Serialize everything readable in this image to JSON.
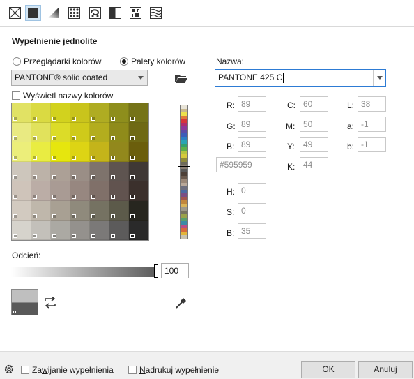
{
  "toolbar": {
    "buttons": [
      {
        "name": "no-fill-icon"
      },
      {
        "name": "uniform-fill-icon",
        "active": true
      },
      {
        "name": "fountain-fill-icon"
      },
      {
        "name": "vector-pattern-fill-icon"
      },
      {
        "name": "bitmap-pattern-fill-icon"
      },
      {
        "name": "two-color-pattern-fill-icon"
      },
      {
        "name": "texture-fill-icon"
      },
      {
        "name": "postscript-fill-icon"
      }
    ]
  },
  "section_title": "Wypełnienie jednolite",
  "mode": {
    "viewers_label": "Przeglądarki kolorów",
    "palettes_label": "Palety kolorów",
    "selected": "palettes"
  },
  "palette": {
    "selected": "PANTONE® solid coated",
    "show_names_label": "Wyświetl nazwy kolorów",
    "show_names_checked": false
  },
  "grid_colors": [
    [
      "#e1e264",
      "#dada42",
      "#d2d21e",
      "#c9c41c",
      "#afac22",
      "#8e8e1c",
      "#757318"
    ],
    [
      "#e9ea82",
      "#e1e25c",
      "#dcdc28",
      "#cfca1a",
      "#b3ad1e",
      "#8f8b1a",
      "#6f6914"
    ],
    [
      "#ecee7a",
      "#e9ec42",
      "#e6e60e",
      "#ddd414",
      "#c4b41a",
      "#92881c",
      "#6b5e0c"
    ],
    [
      "#cdc6bc",
      "#bcb2a8",
      "#aca096",
      "#9a8e86",
      "#7e736c",
      "#5e5450",
      "#3f3835"
    ],
    [
      "#cfc4ba",
      "#bbada6",
      "#a99b94",
      "#978780",
      "#807069",
      "#61534f",
      "#3b302c"
    ],
    [
      "#d2cac0",
      "#bfb7ab",
      "#a8a093",
      "#8f8a7c",
      "#757262",
      "#5c5a4a",
      "#27261f"
    ],
    [
      "#d6d3cc",
      "#c3c0ba",
      "#aba9a3",
      "#94918d",
      "#7b7978",
      "#5c5b5b",
      "#2a2a2a"
    ]
  ],
  "strip_colors": [
    "#e8e4d8",
    "#c9b98f",
    "#ece14d",
    "#e07b3a",
    "#d7363a",
    "#b02e6d",
    "#8e3a9a",
    "#5b4aa7",
    "#3b5cb8",
    "#2a7fc4",
    "#2aa3b3",
    "#34a06d",
    "#5eb04a",
    "#b5c441",
    "#d6c93c",
    "#8f8a3b",
    "#6e6a5a",
    "#8c7f74",
    "#595959",
    "#4d4038",
    "#6b5a4e",
    "#9a8777",
    "#b8a899",
    "#6d6f80",
    "#4c6aa2",
    "#7a4e85",
    "#a3564f",
    "#c2873d",
    "#d9b45a",
    "#9f9a8a",
    "#77735f",
    "#9aa24a",
    "#58a06c",
    "#3a8aa6",
    "#b94d86",
    "#d86a3a",
    "#e3b53a",
    "#c9c3b0"
  ],
  "name": {
    "label": "Nazwa:",
    "value": "PANTONE 425 C"
  },
  "values": {
    "R": "89",
    "G": "89",
    "B": "89",
    "hex": "#595959",
    "C": "60",
    "M": "50",
    "Y": "49",
    "K": "44",
    "L": "38",
    "a": "-1",
    "b": "-1",
    "H": "0",
    "S": "0",
    "Bv": "35"
  },
  "labels": {
    "R": "R:",
    "G": "G:",
    "B": "B:",
    "C": "C:",
    "M": "M:",
    "Y": "Y:",
    "K": "K:",
    "L": "L:",
    "a": "a:",
    "b": "b:",
    "H": "H:",
    "S": "S:",
    "Bv": "B:"
  },
  "tint": {
    "label": "Odcień:",
    "value": "100",
    "level": 1.0
  },
  "swatches": {
    "old": "#bfbfbf",
    "new": "#595959"
  },
  "bottom": {
    "wrap_fill_pre": "Za",
    "wrap_fill_u": "w",
    "wrap_fill_post": "ijanie wypełnienia",
    "overprint_pre": "",
    "overprint_u": "N",
    "overprint_post": "adrukuj wypełnienie",
    "ok_label": "OK",
    "cancel_label": "Anuluj"
  }
}
